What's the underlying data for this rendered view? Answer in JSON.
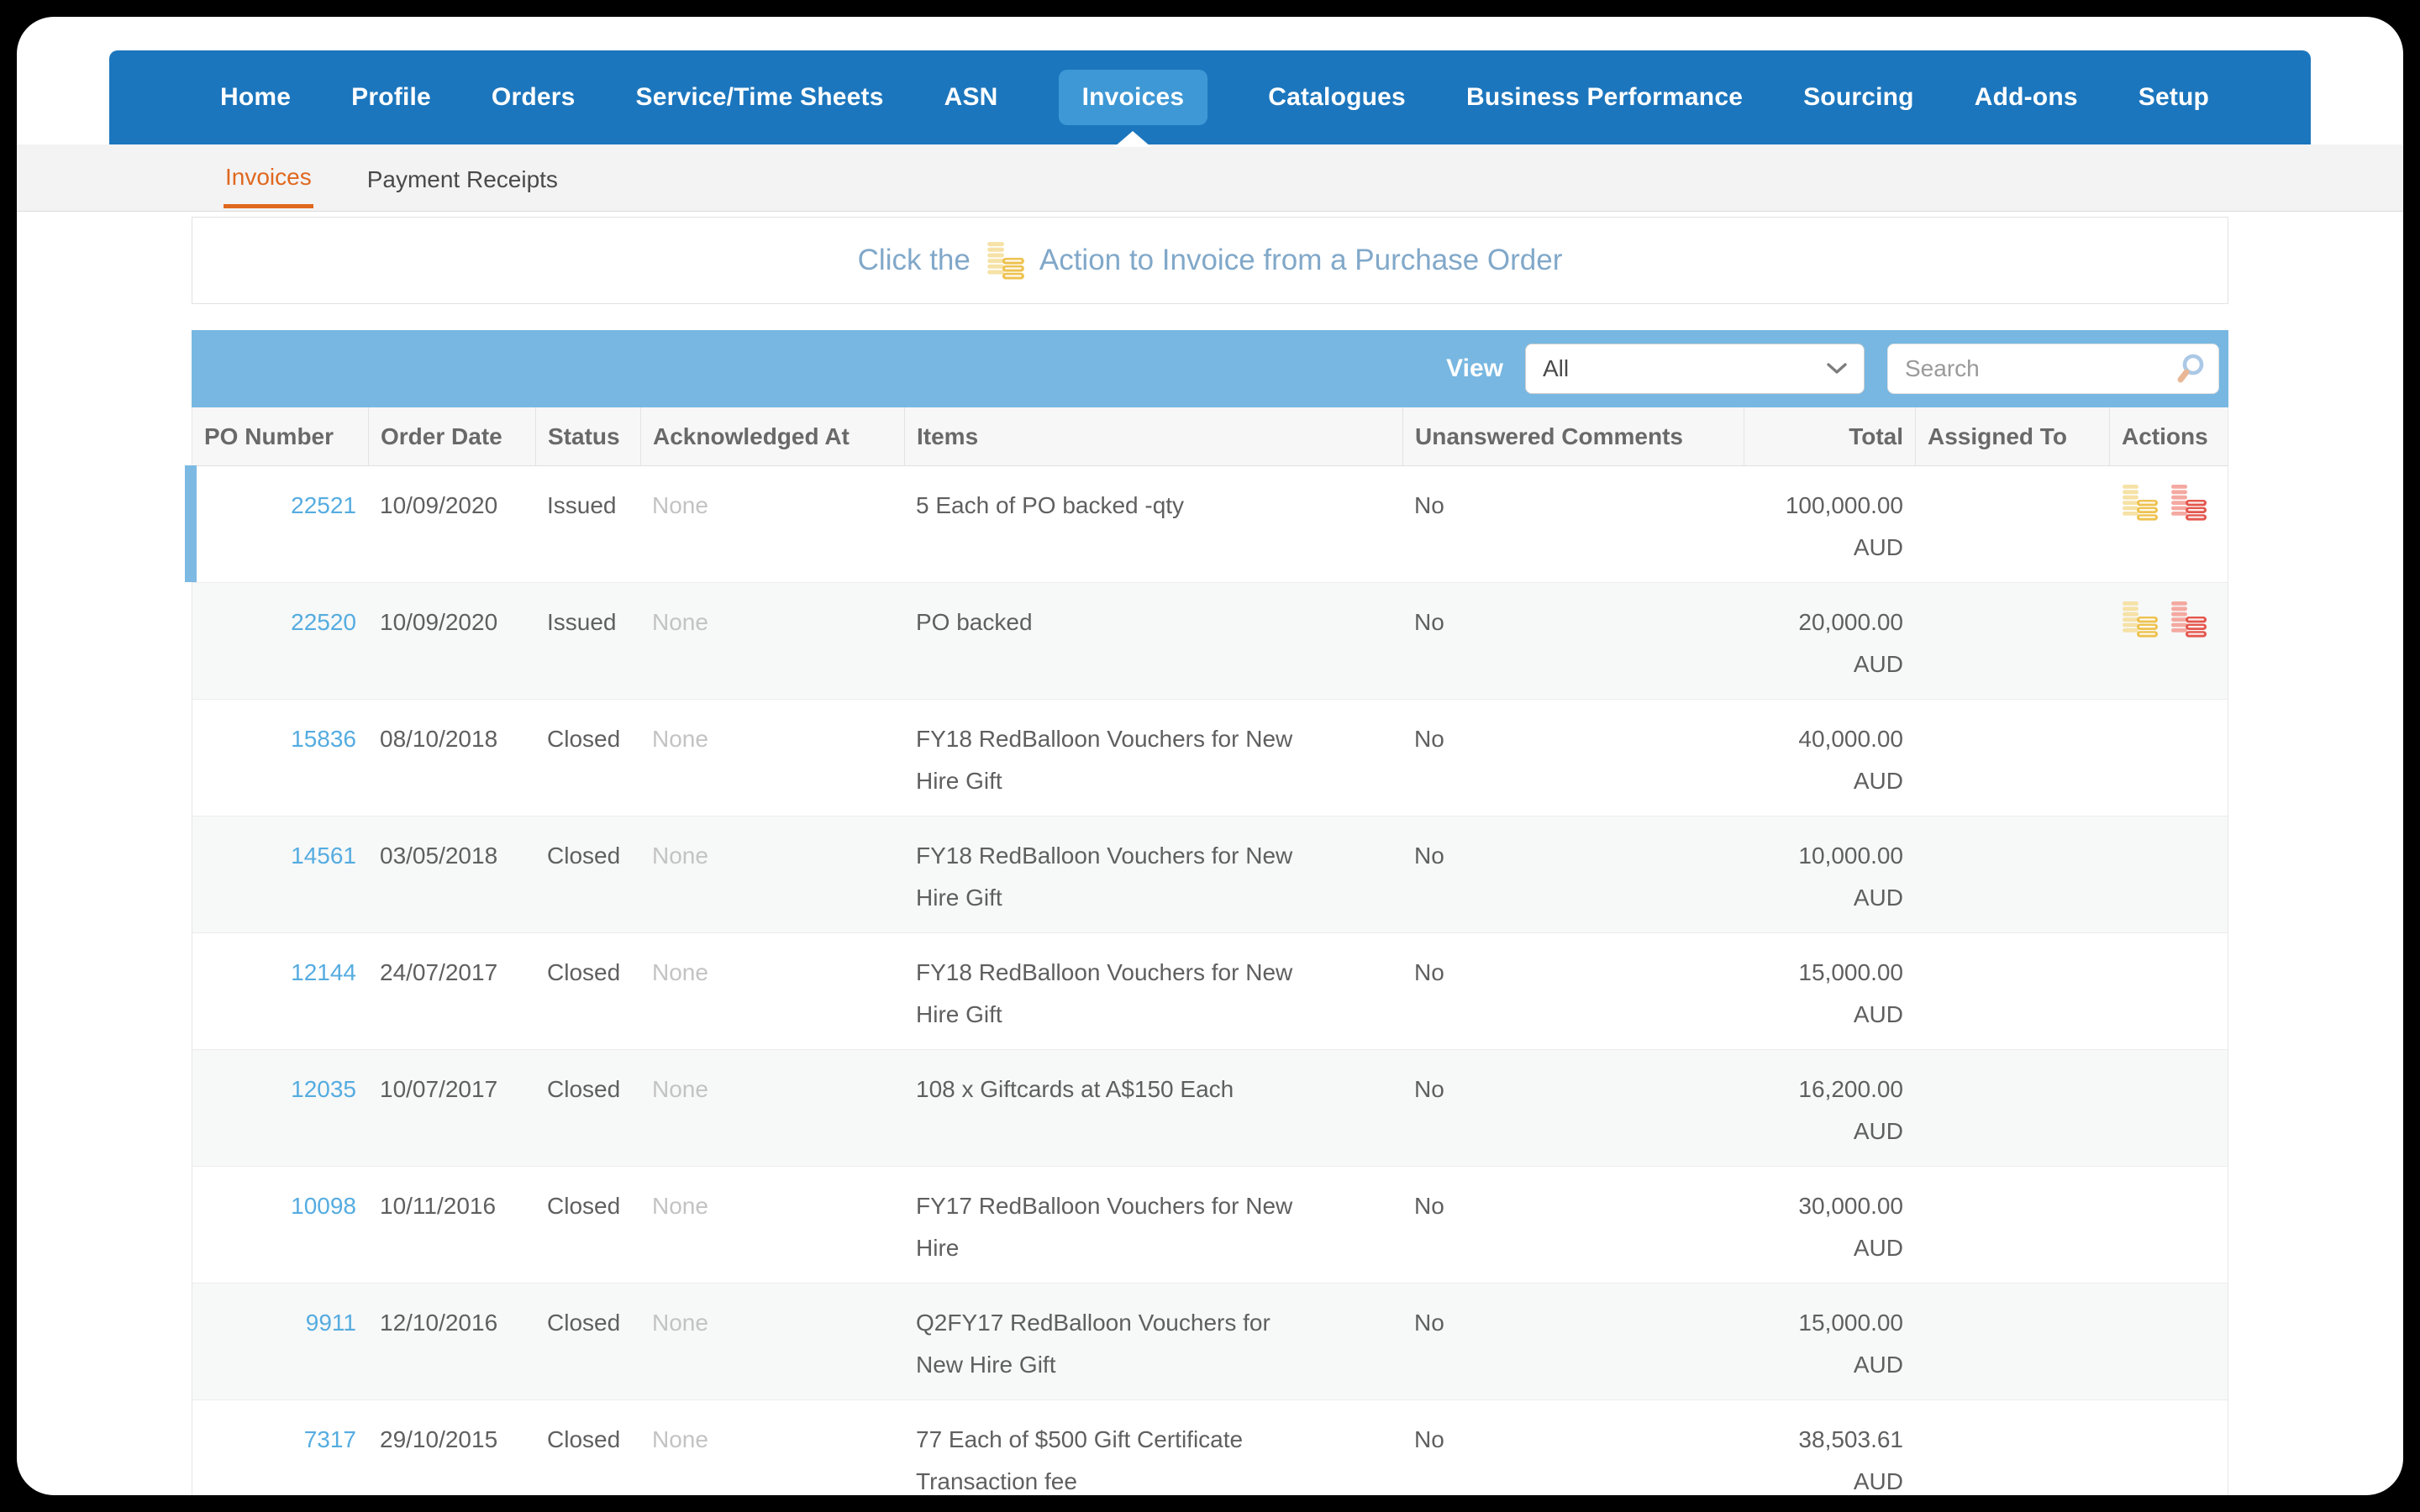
{
  "nav": {
    "items": [
      "Home",
      "Profile",
      "Orders",
      "Service/Time Sheets",
      "ASN",
      "Invoices",
      "Catalogues",
      "Business Performance",
      "Sourcing",
      "Add-ons",
      "Setup"
    ],
    "active_item": "Invoices"
  },
  "subnav": {
    "tabs": [
      "Invoices",
      "Payment Receipts"
    ],
    "active_tab": "Invoices"
  },
  "banner": {
    "text_before_icon": "Click the",
    "text_after_icon": "Action to Invoice from a Purchase Order",
    "icon": "gold-coins-icon"
  },
  "toolbar": {
    "view_label": "View",
    "view_selected": "All",
    "search_placeholder": "Search"
  },
  "table": {
    "columns": [
      "PO Number",
      "Order Date",
      "Status",
      "Acknowledged At",
      "Items",
      "Unanswered Comments",
      "Total",
      "Assigned To",
      "Actions"
    ],
    "rows": [
      {
        "po": "22521",
        "order_date": "10/09/2020",
        "status": "Issued",
        "acknowledged_at": "None",
        "items": "5 Each of PO backed -qty",
        "unanswered_comments": "No",
        "total": "100,000.00",
        "currency": "AUD",
        "assigned_to": "",
        "actions": [
          "gold-coins-invoice",
          "red-coins-credit-note"
        ],
        "highlighted": true
      },
      {
        "po": "22520",
        "order_date": "10/09/2020",
        "status": "Issued",
        "acknowledged_at": "None",
        "items": "PO backed",
        "unanswered_comments": "No",
        "total": "20,000.00",
        "currency": "AUD",
        "assigned_to": "",
        "actions": [
          "gold-coins-invoice",
          "red-coins-credit-note"
        ],
        "highlighted": false
      },
      {
        "po": "15836",
        "order_date": "08/10/2018",
        "status": "Closed",
        "acknowledged_at": "None",
        "items": "FY18 RedBalloon Vouchers for New Hire Gift",
        "unanswered_comments": "No",
        "total": "40,000.00",
        "currency": "AUD",
        "assigned_to": "",
        "actions": [],
        "highlighted": false
      },
      {
        "po": "14561",
        "order_date": "03/05/2018",
        "status": "Closed",
        "acknowledged_at": "None",
        "items": "FY18 RedBalloon Vouchers for New Hire Gift",
        "unanswered_comments": "No",
        "total": "10,000.00",
        "currency": "AUD",
        "assigned_to": "",
        "actions": [],
        "highlighted": false
      },
      {
        "po": "12144",
        "order_date": "24/07/2017",
        "status": "Closed",
        "acknowledged_at": "None",
        "items": "FY18 RedBalloon Vouchers for New Hire Gift",
        "unanswered_comments": "No",
        "total": "15,000.00",
        "currency": "AUD",
        "assigned_to": "",
        "actions": [],
        "highlighted": false
      },
      {
        "po": "12035",
        "order_date": "10/07/2017",
        "status": "Closed",
        "acknowledged_at": "None",
        "items": "108 x Giftcards at A$150 Each",
        "unanswered_comments": "No",
        "total": "16,200.00",
        "currency": "AUD",
        "assigned_to": "",
        "actions": [],
        "highlighted": false
      },
      {
        "po": "10098",
        "order_date": "10/11/2016",
        "status": "Closed",
        "acknowledged_at": "None",
        "items": "FY17 RedBalloon Vouchers for New Hire",
        "unanswered_comments": "No",
        "total": "30,000.00",
        "currency": "AUD",
        "assigned_to": "",
        "actions": [],
        "highlighted": false
      },
      {
        "po": "9911",
        "order_date": "12/10/2016",
        "status": "Closed",
        "acknowledged_at": "None",
        "items": "Q2FY17 RedBalloon Vouchers for New Hire Gift",
        "unanswered_comments": "No",
        "total": "15,000.00",
        "currency": "AUD",
        "assigned_to": "",
        "actions": [],
        "highlighted": false
      },
      {
        "po": "7317",
        "order_date": "29/10/2015",
        "status": "Closed",
        "acknowledged_at": "None",
        "items": "77 Each of $500 Gift Certificate Transaction fee",
        "unanswered_comments": "No",
        "total": "38,503.61",
        "currency": "AUD",
        "assigned_to": "",
        "actions": [],
        "highlighted": false
      }
    ]
  },
  "colors": {
    "nav_blue": "#1c76bd",
    "nav_active_pill": "#3e98d5",
    "toolbar_blue": "#77b7e1",
    "tab_orange": "#e0681e",
    "link_blue": "#55ace0",
    "banner_text": "#81a8c9",
    "row_accent": "#7cb9e3",
    "coin_gold_light": "#f8e7b0",
    "coin_gold_dark": "#eec24f",
    "coin_red_light": "#f4a9a1",
    "coin_red_dark": "#e4574e"
  }
}
